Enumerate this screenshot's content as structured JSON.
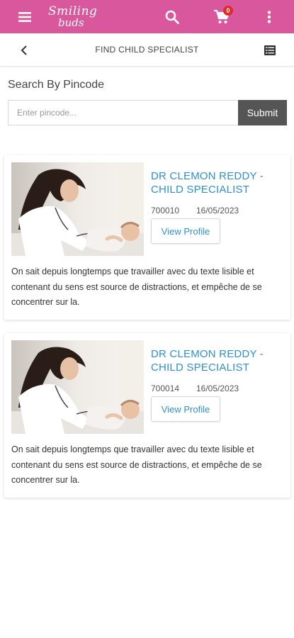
{
  "app": {
    "logo_line1": "Smiling",
    "logo_line2": "buds",
    "cart_count": "0",
    "icons": {
      "menu": "menu-icon",
      "search": "search-icon",
      "cart": "cart-icon",
      "more": "more-vertical-icon"
    },
    "colors": {
      "header": "#d9589d",
      "accent_text": "#2f8fd0",
      "submit": "#555555",
      "badge": "#e02b2b"
    }
  },
  "subheader": {
    "title": "FIND CHILD SPECIALIST",
    "back_icon": "chevron-left-icon",
    "list_icon": "list-view-icon"
  },
  "search": {
    "label": "Search By Pincode",
    "placeholder": "Enter pincode...",
    "value": "",
    "submit_label": "Submit"
  },
  "specialists": [
    {
      "name": "DR CLEMON REDDY - CHILD SPECIALIST",
      "pincode": "700010",
      "date": "16/05/2023",
      "button_label": "View Profile",
      "description": "On sait depuis longtemps que travailler avec du texte lisible et contenant du sens est source de distractions, et empêche de se concentrer sur la."
    },
    {
      "name": "DR CLEMON REDDY - CHILD SPECIALIST",
      "pincode": "700014",
      "date": "16/05/2023",
      "button_label": "View Profile",
      "description": "On sait depuis longtemps que travailler avec du texte lisible et contenant du sens est source de distractions, et empêche de se concentrer sur la."
    }
  ]
}
